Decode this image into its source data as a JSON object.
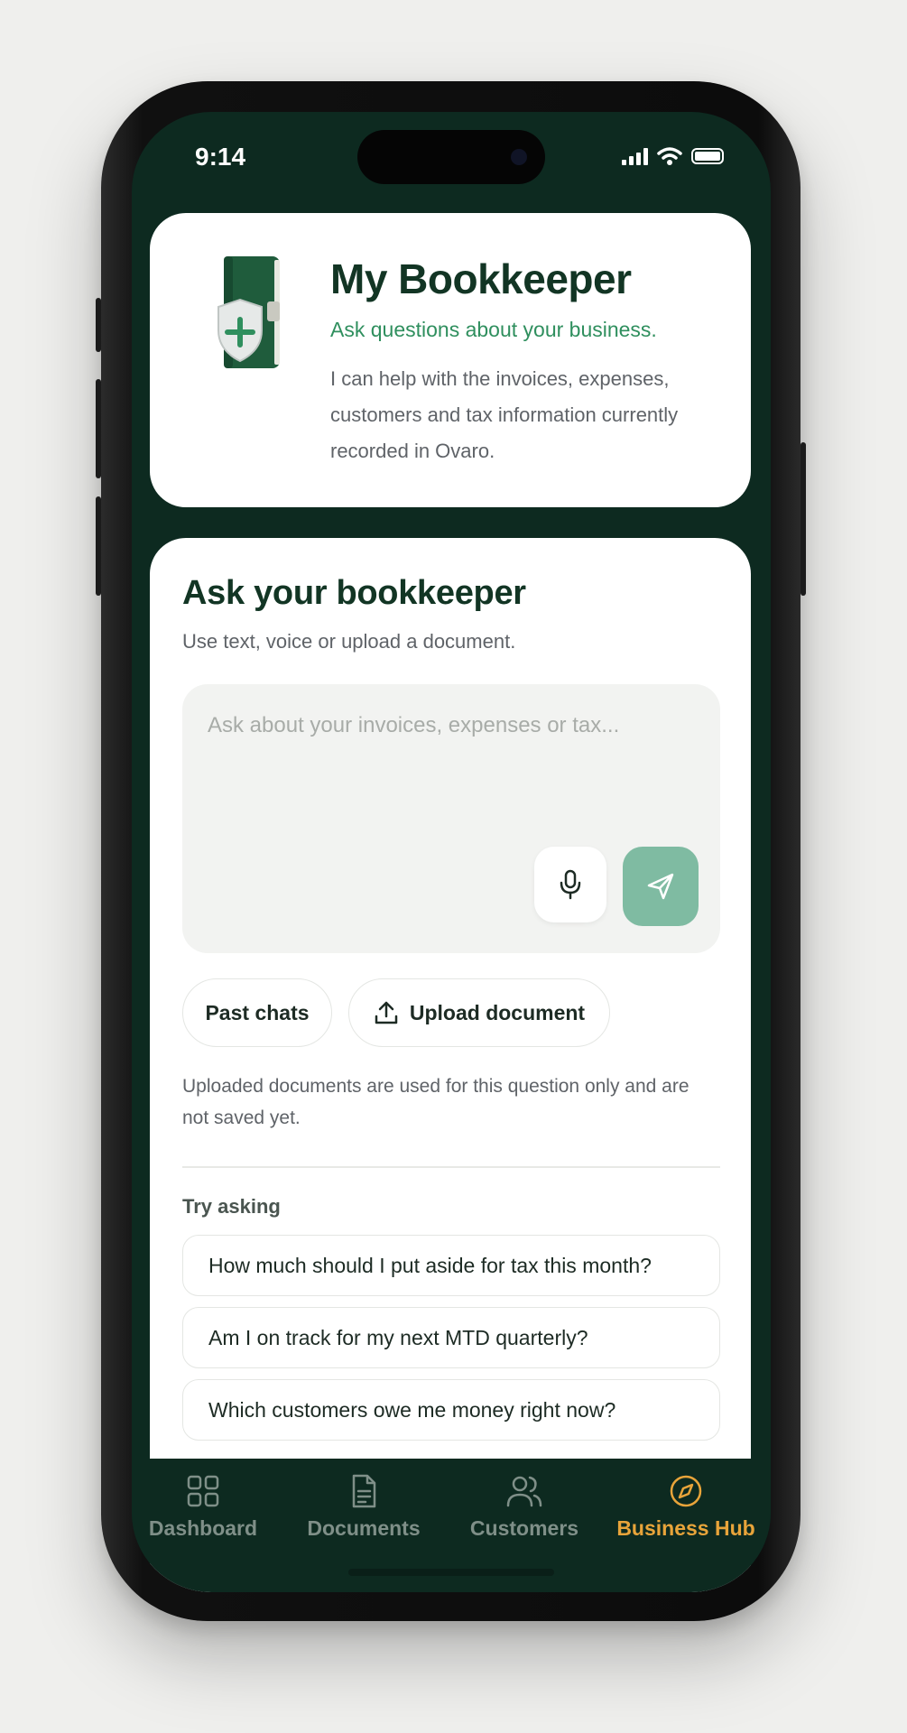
{
  "status_bar": {
    "time": "9:14"
  },
  "header_card": {
    "title": "My Bookkeeper",
    "subtitle": "Ask questions about your business.",
    "description": "I can help with the invoices, expenses, customers and tax information currently recorded in Ovaro."
  },
  "ask_card": {
    "title": "Ask your bookkeeper",
    "subtitle": "Use text, voice or upload a document.",
    "input_placeholder": "Ask about your invoices, expenses or tax...",
    "input_value": "",
    "past_chats_label": "Past chats",
    "upload_label": "Upload document",
    "note": "Uploaded documents are used for this question only and are not saved yet.",
    "try_label": "Try asking",
    "suggestions": [
      "How much should I put aside for tax this month?",
      "Am I on track for my next MTD quarterly?",
      "Which customers owe me money right now?"
    ]
  },
  "tabs": [
    {
      "label": "Dashboard",
      "icon": "grid-icon",
      "active": false
    },
    {
      "label": "Documents",
      "icon": "document-icon",
      "active": false
    },
    {
      "label": "Customers",
      "icon": "users-icon",
      "active": false
    },
    {
      "label": "Business Hub",
      "icon": "compass-icon",
      "active": true
    }
  ],
  "colors": {
    "brand_dark": "#0d2a20",
    "accent_green": "#2f8f5e",
    "send_button": "#7fbba2",
    "active_tab": "#e8a43a"
  }
}
